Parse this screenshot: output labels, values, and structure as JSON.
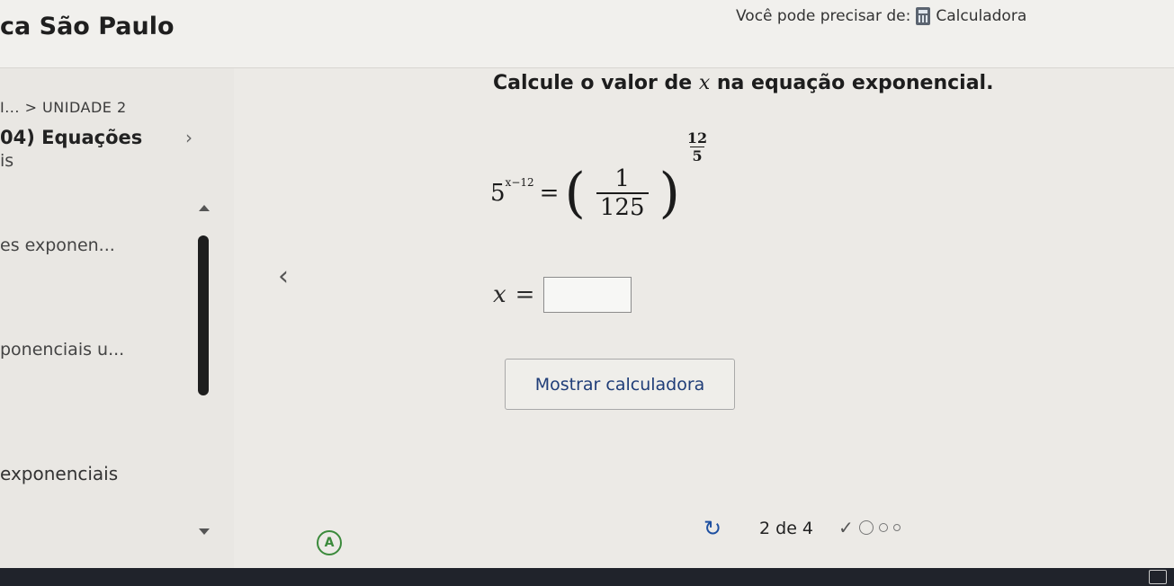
{
  "header": {
    "school_name": "ca São Paulo",
    "tools_label": "Você pode precisar de:",
    "calculator_label": "Calculadora"
  },
  "sidebar": {
    "breadcrumb": "I... > UNIDADE 2",
    "section_title": "04) Equações",
    "items": [
      "is",
      "es exponen...",
      "ponenciais u...",
      "exponenciais"
    ]
  },
  "question": {
    "prompt_before": "Calcule o valor de ",
    "prompt_var": "x",
    "prompt_after": " na equação exponencial.",
    "base": "5",
    "base_exponent": "x−12",
    "fraction_num": "1",
    "fraction_den": "125",
    "outer_exp_num": "12",
    "outer_exp_den": "5",
    "answer_var": "x",
    "answer_eq": "=",
    "answer_value": ""
  },
  "buttons": {
    "show_calculator": "Mostrar calculadora"
  },
  "footer": {
    "page_indicator": "2 de 4",
    "accessibility_letter": "A"
  }
}
